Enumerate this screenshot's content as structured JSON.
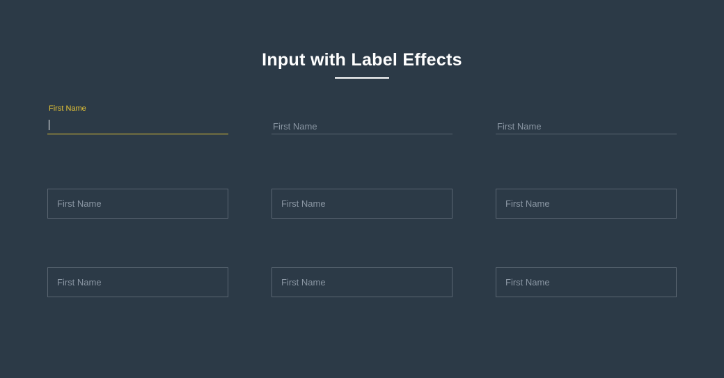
{
  "header": {
    "title": "Input with Label Effects"
  },
  "rows": {
    "r1": {
      "f1": {
        "label": "First Name"
      },
      "f2": {
        "label": "First Name"
      },
      "f3": {
        "label": "First Name"
      }
    },
    "r2": {
      "f1": {
        "label": "First Name"
      },
      "f2": {
        "label": "First Name"
      },
      "f3": {
        "label": "First Name"
      }
    },
    "r3": {
      "f1": {
        "label": "First Name"
      },
      "f2": {
        "label": "First Name"
      },
      "f3": {
        "label": "First Name"
      }
    }
  },
  "colors": {
    "accent": "#e8c636",
    "bg": "#2c3a47",
    "muted": "#8a96a3",
    "border": "#5a6672"
  }
}
